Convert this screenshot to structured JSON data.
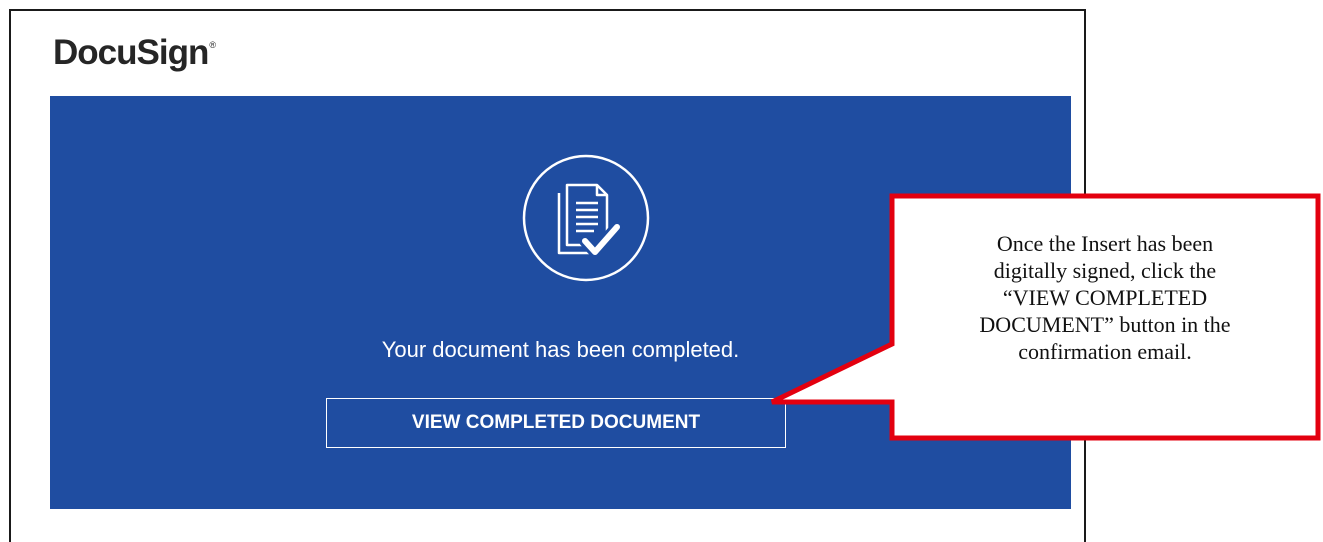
{
  "email": {
    "logo_text": "DocuSign",
    "logo_mark": "®",
    "icon": "document-check-icon",
    "message": "Your document has been completed.",
    "button_label": "VIEW COMPLETED DOCUMENT"
  },
  "callout": {
    "line1": "Once the Insert has been",
    "line2": "digitally signed, click the",
    "line3": "“VIEW COMPLETED",
    "line4": "DOCUMENT” button in the",
    "line5": "confirmation email."
  },
  "colors": {
    "banner": "#1f4da1",
    "callout_border": "#e3000f",
    "frame_border": "#1a1a1a",
    "text_on_banner": "#ffffff"
  }
}
